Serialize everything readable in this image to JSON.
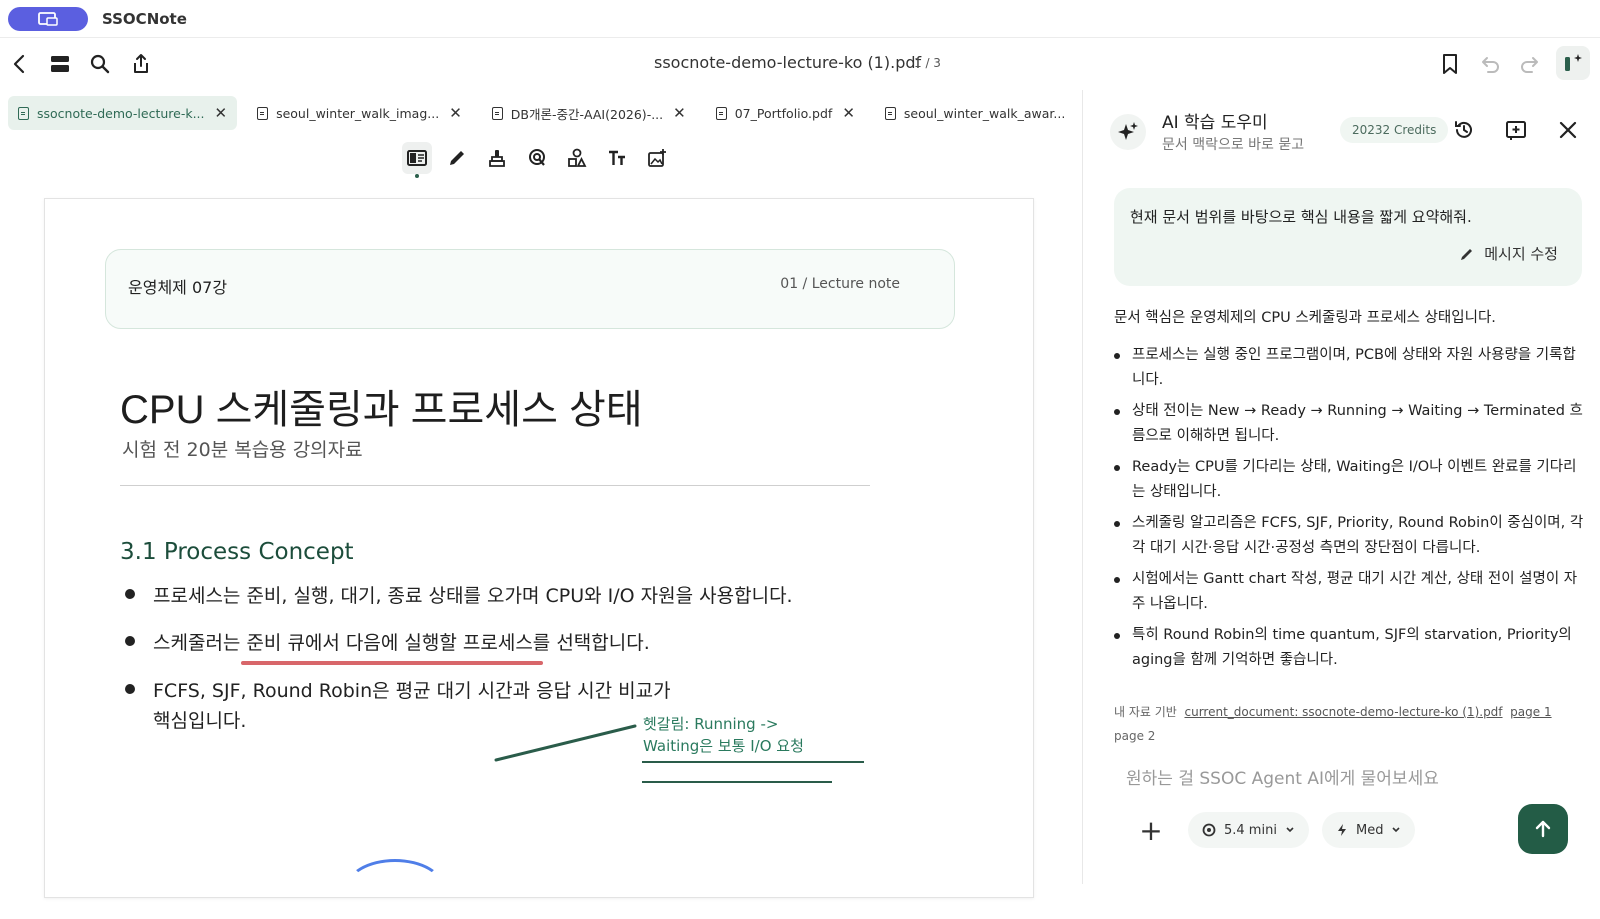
{
  "app": {
    "name": "SSOCNote",
    "accent": "#5b5fe0",
    "brand_green": "#235c46"
  },
  "toolbar": {
    "doc_title": "ssocnote-demo-lecture-ko (1).pdf",
    "page_count": "1 / 3"
  },
  "tabs": [
    {
      "label": "ssocnote-demo-lecture-k...",
      "active": true
    },
    {
      "label": "seoul_winter_walk_imag...",
      "active": false
    },
    {
      "label": "DB개론-중간-AAI(2026)-...",
      "active": false
    },
    {
      "label": "07_Portfolio.pdf",
      "active": false
    },
    {
      "label": "seoul_winter_walk_awar...",
      "active": false
    }
  ],
  "document": {
    "box_left": "운영체제 07강",
    "box_right": "01 / Lecture note",
    "title": "CPU 스케줄링과 프로세스 상태",
    "subtitle": "시험 전 20분 복습용 강의자료",
    "section": "3.1 Process Concept",
    "bullets": [
      "프로세스는 준비, 실행, 대기, 종료 상태를 오가며 CPU와 I/O 자원을 사용합니다.",
      "스케줄러는 준비 큐에서 다음에 실행할 프로세스를 선택합니다.",
      "FCFS, SJF, Round Robin은 평균 대기 시간과 응답 시간 비교가",
      "핵심입니다."
    ],
    "handwritten_note": [
      "헷갈림: Running ->",
      "Waiting은 보통 I/O 요청"
    ]
  },
  "ai_panel": {
    "title": "AI 학습 도우미",
    "subtitle": "문서 맥락으로 바로 묻고",
    "credits": "20232 Credits",
    "user_message": "현재 문서 범위를 바탕으로 핵심 내용을 짧게 요약해줘.",
    "edit_label": "메시지 수정",
    "answer_intro": "문서 핵심은 운영체제의 CPU 스케줄링과 프로세스 상태입니다.",
    "answer_points": [
      "프로세스는 실행 중인 프로그램이며, PCB에 상태와 자원 사용량을 기록합니다.",
      "상태 전이는 New → Ready → Running → Waiting → Terminated 흐름으로 이해하면 됩니다.",
      "Ready는 CPU를 기다리는 상태, Waiting은 I/O나 이벤트 완료를 기다리는 상태입니다.",
      "스케줄링 알고리즘은 FCFS, SJF, Priority, Round Robin이 중심이며, 각각 대기 시간·응답 시간·공정성 측면의 장단점이 다릅니다.",
      "시험에서는 Gantt chart 작성, 평균 대기 시간 계산, 상태 전이 설명이 자주 나옵니다.",
      "특히 Round Robin의 time quantum, SJF의 starvation, Priority의 aging을 함께 기억하면 좋습니다."
    ],
    "source_prefix": "내 자료 기반",
    "source_link": "current_document: ssocnote-demo-lecture-ko (1).pdf",
    "source_page1": "page 1",
    "source_page2": "page 2",
    "composer_placeholder": "원하는 걸 SSOC Agent AI에게 물어보세요",
    "model": "5.4 mini",
    "effort": "Med"
  }
}
